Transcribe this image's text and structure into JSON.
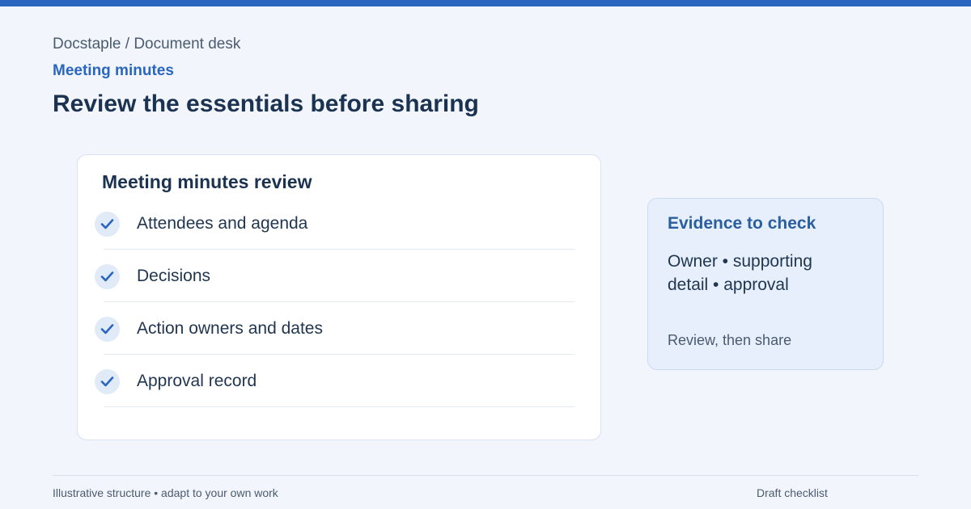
{
  "header": {
    "breadcrumb": "Docstaple / Document desk",
    "kicker": "Meeting minutes",
    "title": "Review the essentials before sharing"
  },
  "checklist": {
    "title": "Meeting minutes review",
    "items": [
      {
        "label": "Attendees and agenda",
        "checked": true,
        "icon": "check-icon"
      },
      {
        "label": "Decisions",
        "checked": true,
        "icon": "check-icon"
      },
      {
        "label": "Action owners and dates",
        "checked": true,
        "icon": "check-icon"
      },
      {
        "label": "Approval record",
        "checked": true,
        "icon": "check-icon"
      }
    ]
  },
  "evidence": {
    "title": "Evidence to check",
    "text": "Owner • supporting detail • approval",
    "note": "Review, then share"
  },
  "footer": {
    "left": "Illustrative structure • adapt to your own work",
    "right": "Draft checklist"
  },
  "colors": {
    "accent": "#2a66c0",
    "background": "#f2f6fc",
    "heading": "#1b3350",
    "evidence_panel": "#e6effb"
  }
}
